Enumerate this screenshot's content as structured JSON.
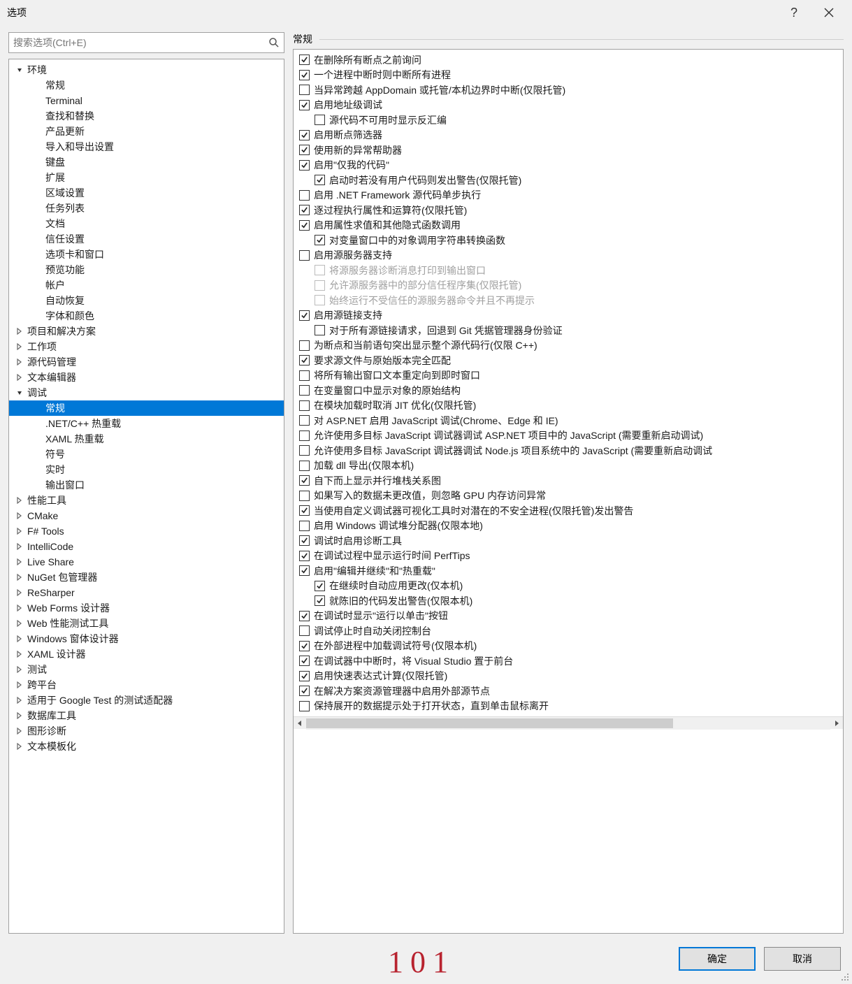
{
  "window": {
    "title": "选项",
    "help_tooltip": "帮助",
    "close_tooltip": "关闭"
  },
  "search": {
    "placeholder": "搜索选项(Ctrl+E)"
  },
  "tree": [
    {
      "label": "环境",
      "depth": 0,
      "toggle": "down",
      "selected": false
    },
    {
      "label": "常规",
      "depth": 1,
      "toggle": "",
      "selected": false
    },
    {
      "label": "Terminal",
      "depth": 1,
      "toggle": "",
      "selected": false
    },
    {
      "label": "查找和替换",
      "depth": 1,
      "toggle": "",
      "selected": false
    },
    {
      "label": "产品更新",
      "depth": 1,
      "toggle": "",
      "selected": false
    },
    {
      "label": "导入和导出设置",
      "depth": 1,
      "toggle": "",
      "selected": false
    },
    {
      "label": "键盘",
      "depth": 1,
      "toggle": "",
      "selected": false
    },
    {
      "label": "扩展",
      "depth": 1,
      "toggle": "",
      "selected": false
    },
    {
      "label": "区域设置",
      "depth": 1,
      "toggle": "",
      "selected": false
    },
    {
      "label": "任务列表",
      "depth": 1,
      "toggle": "",
      "selected": false
    },
    {
      "label": "文档",
      "depth": 1,
      "toggle": "",
      "selected": false
    },
    {
      "label": "信任设置",
      "depth": 1,
      "toggle": "",
      "selected": false
    },
    {
      "label": "选项卡和窗口",
      "depth": 1,
      "toggle": "",
      "selected": false
    },
    {
      "label": "预览功能",
      "depth": 1,
      "toggle": "",
      "selected": false
    },
    {
      "label": "帐户",
      "depth": 1,
      "toggle": "",
      "selected": false
    },
    {
      "label": "自动恢复",
      "depth": 1,
      "toggle": "",
      "selected": false
    },
    {
      "label": "字体和颜色",
      "depth": 1,
      "toggle": "",
      "selected": false
    },
    {
      "label": "项目和解决方案",
      "depth": 0,
      "toggle": "right",
      "selected": false
    },
    {
      "label": "工作项",
      "depth": 0,
      "toggle": "right",
      "selected": false
    },
    {
      "label": "源代码管理",
      "depth": 0,
      "toggle": "right",
      "selected": false
    },
    {
      "label": "文本编辑器",
      "depth": 0,
      "toggle": "right",
      "selected": false
    },
    {
      "label": "调试",
      "depth": 0,
      "toggle": "down",
      "selected": false
    },
    {
      "label": "常规",
      "depth": 1,
      "toggle": "",
      "selected": true
    },
    {
      "label": ".NET/C++ 热重载",
      "depth": 1,
      "toggle": "",
      "selected": false
    },
    {
      "label": "XAML 热重载",
      "depth": 1,
      "toggle": "",
      "selected": false
    },
    {
      "label": "符号",
      "depth": 1,
      "toggle": "",
      "selected": false
    },
    {
      "label": "实时",
      "depth": 1,
      "toggle": "",
      "selected": false
    },
    {
      "label": "输出窗口",
      "depth": 1,
      "toggle": "",
      "selected": false
    },
    {
      "label": "性能工具",
      "depth": 0,
      "toggle": "right",
      "selected": false
    },
    {
      "label": "CMake",
      "depth": 0,
      "toggle": "right",
      "selected": false
    },
    {
      "label": "F# Tools",
      "depth": 0,
      "toggle": "right",
      "selected": false
    },
    {
      "label": "IntelliCode",
      "depth": 0,
      "toggle": "right",
      "selected": false
    },
    {
      "label": "Live Share",
      "depth": 0,
      "toggle": "right",
      "selected": false
    },
    {
      "label": "NuGet 包管理器",
      "depth": 0,
      "toggle": "right",
      "selected": false
    },
    {
      "label": "ReSharper",
      "depth": 0,
      "toggle": "right",
      "selected": false
    },
    {
      "label": "Web Forms 设计器",
      "depth": 0,
      "toggle": "right",
      "selected": false
    },
    {
      "label": "Web 性能测试工具",
      "depth": 0,
      "toggle": "right",
      "selected": false
    },
    {
      "label": "Windows 窗体设计器",
      "depth": 0,
      "toggle": "right",
      "selected": false
    },
    {
      "label": "XAML 设计器",
      "depth": 0,
      "toggle": "right",
      "selected": false
    },
    {
      "label": "测试",
      "depth": 0,
      "toggle": "right",
      "selected": false
    },
    {
      "label": "跨平台",
      "depth": 0,
      "toggle": "right",
      "selected": false
    },
    {
      "label": "适用于 Google Test 的测试适配器",
      "depth": 0,
      "toggle": "right",
      "selected": false
    },
    {
      "label": "数据库工具",
      "depth": 0,
      "toggle": "right",
      "selected": false
    },
    {
      "label": "图形诊断",
      "depth": 0,
      "toggle": "right",
      "selected": false
    },
    {
      "label": "文本模板化",
      "depth": 0,
      "toggle": "right",
      "selected": false
    }
  ],
  "section_title": "常规",
  "options": [
    {
      "label": "在删除所有断点之前询问",
      "indent": 0,
      "checked": true,
      "disabled": false
    },
    {
      "label": "一个进程中断时则中断所有进程",
      "indent": 0,
      "checked": true,
      "disabled": false
    },
    {
      "label": "当异常跨越 AppDomain 或托管/本机边界时中断(仅限托管)",
      "indent": 0,
      "checked": false,
      "disabled": false
    },
    {
      "label": "启用地址级调试",
      "indent": 0,
      "checked": true,
      "disabled": false
    },
    {
      "label": "源代码不可用时显示反汇编",
      "indent": 1,
      "checked": false,
      "disabled": false
    },
    {
      "label": "启用断点筛选器",
      "indent": 0,
      "checked": true,
      "disabled": false
    },
    {
      "label": "使用新的异常帮助器",
      "indent": 0,
      "checked": true,
      "disabled": false
    },
    {
      "label": "启用\"仅我的代码\"",
      "indent": 0,
      "checked": true,
      "disabled": false
    },
    {
      "label": "启动时若没有用户代码则发出警告(仅限托管)",
      "indent": 1,
      "checked": true,
      "disabled": false
    },
    {
      "label": "启用 .NET Framework 源代码单步执行",
      "indent": 0,
      "checked": false,
      "disabled": false
    },
    {
      "label": "逐过程执行属性和运算符(仅限托管)",
      "indent": 0,
      "checked": true,
      "disabled": false
    },
    {
      "label": "启用属性求值和其他隐式函数调用",
      "indent": 0,
      "checked": true,
      "disabled": false
    },
    {
      "label": "对变量窗口中的对象调用字符串转换函数",
      "indent": 1,
      "checked": true,
      "disabled": false
    },
    {
      "label": "启用源服务器支持",
      "indent": 0,
      "checked": false,
      "disabled": false
    },
    {
      "label": "将源服务器诊断消息打印到输出窗口",
      "indent": 1,
      "checked": false,
      "disabled": true
    },
    {
      "label": "允许源服务器中的部分信任程序集(仅限托管)",
      "indent": 1,
      "checked": false,
      "disabled": true
    },
    {
      "label": "始终运行不受信任的源服务器命令并且不再提示",
      "indent": 1,
      "checked": false,
      "disabled": true
    },
    {
      "label": "启用源链接支持",
      "indent": 0,
      "checked": true,
      "disabled": false
    },
    {
      "label": "对于所有源链接请求，回退到 Git 凭据管理器身份验证",
      "indent": 1,
      "checked": false,
      "disabled": false
    },
    {
      "label": "为断点和当前语句突出显示整个源代码行(仅限 C++)",
      "indent": 0,
      "checked": false,
      "disabled": false
    },
    {
      "label": "要求源文件与原始版本完全匹配",
      "indent": 0,
      "checked": true,
      "disabled": false
    },
    {
      "label": "将所有输出窗口文本重定向到即时窗口",
      "indent": 0,
      "checked": false,
      "disabled": false
    },
    {
      "label": "在变量窗口中显示对象的原始结构",
      "indent": 0,
      "checked": false,
      "disabled": false
    },
    {
      "label": "在模块加载时取消 JIT 优化(仅限托管)",
      "indent": 0,
      "checked": false,
      "disabled": false
    },
    {
      "label": "对 ASP.NET 启用 JavaScript 调试(Chrome、Edge 和 IE)",
      "indent": 0,
      "checked": false,
      "disabled": false
    },
    {
      "label": "允许使用多目标 JavaScript 调试器调试 ASP.NET 项目中的 JavaScript (需要重新启动调试)",
      "indent": 0,
      "checked": false,
      "disabled": false
    },
    {
      "label": "允许使用多目标 JavaScript 调试器调试 Node.js 项目系统中的 JavaScript (需要重新启动调试",
      "indent": 0,
      "checked": false,
      "disabled": false
    },
    {
      "label": "加载 dll 导出(仅限本机)",
      "indent": 0,
      "checked": false,
      "disabled": false
    },
    {
      "label": "自下而上显示并行堆栈关系图",
      "indent": 0,
      "checked": true,
      "disabled": false
    },
    {
      "label": "如果写入的数据未更改值，则忽略 GPU 内存访问异常",
      "indent": 0,
      "checked": false,
      "disabled": false
    },
    {
      "label": "当使用自定义调试器可视化工具时对潜在的不安全进程(仅限托管)发出警告",
      "indent": 0,
      "checked": true,
      "disabled": false
    },
    {
      "label": "启用 Windows 调试堆分配器(仅限本地)",
      "indent": 0,
      "checked": false,
      "disabled": false
    },
    {
      "label": "调试时启用诊断工具",
      "indent": 0,
      "checked": true,
      "disabled": false
    },
    {
      "label": "在调试过程中显示运行时间 PerfTips",
      "indent": 0,
      "checked": true,
      "disabled": false
    },
    {
      "label": "启用\"编辑并继续\"和\"热重载\"",
      "indent": 0,
      "checked": true,
      "disabled": false
    },
    {
      "label": "在继续时自动应用更改(仅本机)",
      "indent": 1,
      "checked": true,
      "disabled": false
    },
    {
      "label": "就陈旧的代码发出警告(仅限本机)",
      "indent": 1,
      "checked": true,
      "disabled": false
    },
    {
      "label": "在调试时显示\"运行以单击\"按钮",
      "indent": 0,
      "checked": true,
      "disabled": false
    },
    {
      "label": "调试停止时自动关闭控制台",
      "indent": 0,
      "checked": false,
      "disabled": false
    },
    {
      "label": "在外部进程中加载调试符号(仅限本机)",
      "indent": 0,
      "checked": true,
      "disabled": false
    },
    {
      "label": "在调试器中中断时，将 Visual Studio 置于前台",
      "indent": 0,
      "checked": true,
      "disabled": false
    },
    {
      "label": "启用快速表达式计算(仅限托管)",
      "indent": 0,
      "checked": true,
      "disabled": false
    },
    {
      "label": "在解决方案资源管理器中启用外部源节点",
      "indent": 0,
      "checked": true,
      "disabled": false
    },
    {
      "label": "保持展开的数据提示处于打开状态，直到单击鼠标离开",
      "indent": 0,
      "checked": false,
      "disabled": false
    }
  ],
  "buttons": {
    "ok": "确定",
    "cancel": "取消"
  },
  "annotation": "101"
}
